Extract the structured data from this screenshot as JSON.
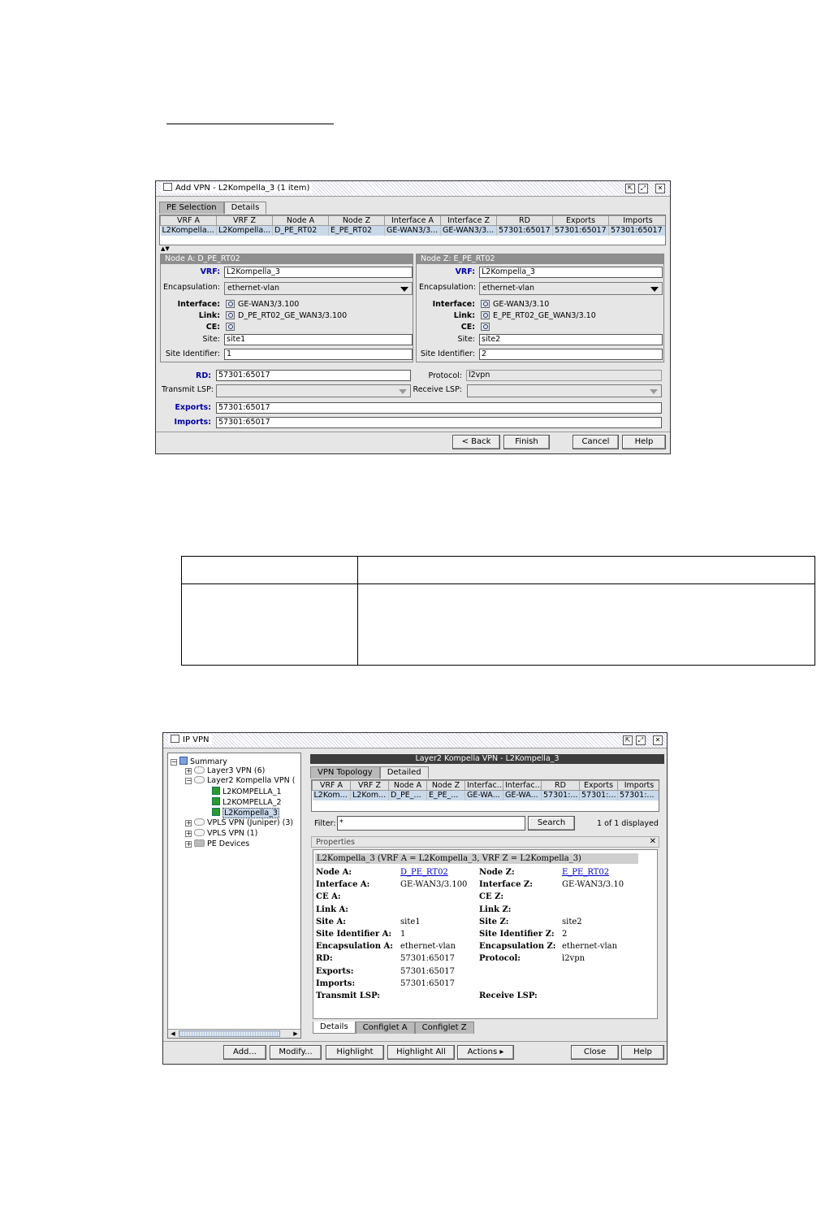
{
  "dialog1": {
    "title": "Add VPN - L2Kompella_3 (1 item)",
    "tabs": [
      "PE Selection",
      "Details"
    ],
    "columns": [
      "VRF A",
      "VRF Z",
      "Node A",
      "Node Z",
      "Interface A",
      "Interface Z",
      "RD",
      "Exports",
      "Imports"
    ],
    "row": [
      "L2Kompella...",
      "L2Kompella...",
      "D_PE_RT02",
      "E_PE_RT02",
      "GE-WAN3/3...",
      "GE-WAN3/3...",
      "57301:65017",
      "57301:65017",
      "57301:65017"
    ],
    "nodeA": {
      "header": "Node A: D_PE_RT02",
      "vrf_label": "VRF:",
      "vrf": "L2Kompella_3",
      "encap_label": "Encapsulation:",
      "encap": "ethernet-vlan",
      "interface_label": "Interface:",
      "interface": "GE-WAN3/3.100",
      "link_label": "Link:",
      "link": "D_PE_RT02_GE_WAN3/3.100",
      "ce_label": "CE:",
      "site_label": "Site:",
      "site": "site1",
      "siteid_label": "Site Identifier:",
      "siteid": "1"
    },
    "nodeZ": {
      "header": "Node Z: E_PE_RT02",
      "vrf_label": "VRF:",
      "vrf": "L2Kompella_3",
      "encap_label": "Encapsulation:",
      "encap": "ethernet-vlan",
      "interface_label": "Interface:",
      "interface": "GE-WAN3/3.10",
      "link_label": "Link:",
      "link": "E_PE_RT02_GE_WAN3/3.10",
      "ce_label": "CE:",
      "site_label": "Site:",
      "site": "site2",
      "siteid_label": "Site Identifier:",
      "siteid": "2"
    },
    "rd_label": "RD:",
    "rd": "57301:65017",
    "protocol_label": "Protocol:",
    "protocol": "l2vpn",
    "tx_label": "Transmit LSP:",
    "rx_label": "Receive LSP:",
    "exports_label": "Exports:",
    "exports": "57301:65017",
    "imports_label": "Imports:",
    "imports": "57301:65017",
    "buttons": {
      "back": "< Back",
      "finish": "Finish",
      "cancel": "Cancel",
      "help": "Help"
    }
  },
  "dialog2": {
    "title": "IP VPN",
    "tree": {
      "summary": "Summary",
      "l3": "Layer3 VPN (6)",
      "l2k": "Layer2 Kompella VPN (",
      "k1": "L2KOMPELLA_1",
      "k2": "L2KOMPELLA_2",
      "k3": "L2Kompella_3",
      "vplsj": "VPLS VPN (Juniper) (3)",
      "vpls": "VPLS VPN (1)",
      "pe": "PE Devices"
    },
    "header": "Layer2 Kompella VPN - L2Kompella_3",
    "tabs": [
      "VPN Topology",
      "Detailed"
    ],
    "columns": [
      "VRF A",
      "VRF Z",
      "Node A",
      "Node Z",
      "Interfac...",
      "Interfac...",
      "RD",
      "Exports",
      "Imports"
    ],
    "row": [
      "L2Kom...",
      "L2Kom...",
      "D_PE_...",
      "E_PE_...",
      "GE-WA...",
      "GE-WA...",
      "57301:...",
      "57301:...",
      "57301:..."
    ],
    "filter_label": "Filter:",
    "filter_value": "*",
    "search_button": "Search",
    "count": "1 of 1 displayed",
    "properties_title": "Properties",
    "close_glyph": "✕",
    "props_heading": "L2Kompella_3   (VRF A = L2Kompella_3, VRF Z = L2Kompella_3)",
    "left": [
      {
        "k": "Node A:",
        "v": "D_PE_RT02"
      },
      {
        "k": "Interface A:",
        "v": "GE-WAN3/3.100"
      },
      {
        "k": "CE A:",
        "v": ""
      },
      {
        "k": "Link A:",
        "v": ""
      },
      {
        "k": "Site A:",
        "v": "site1"
      },
      {
        "k": "Site Identifier A:",
        "v": "1"
      },
      {
        "k": "Encapsulation A:",
        "v": "ethernet-vlan"
      },
      {
        "k": "RD:",
        "v": "57301:65017"
      },
      {
        "k": "Exports:",
        "v": "57301:65017"
      },
      {
        "k": "Imports:",
        "v": "57301:65017"
      },
      {
        "k": "Transmit LSP:",
        "v": ""
      }
    ],
    "right": [
      {
        "k": "Node Z:",
        "v": "E_PE_RT02"
      },
      {
        "k": "Interface Z:",
        "v": "GE-WAN3/3.10"
      },
      {
        "k": "CE Z:",
        "v": ""
      },
      {
        "k": "Link Z:",
        "v": ""
      },
      {
        "k": "Site Z:",
        "v": "site2"
      },
      {
        "k": "Site Identifier Z:",
        "v": "2"
      },
      {
        "k": "Encapsulation Z:",
        "v": "ethernet-vlan"
      },
      {
        "k": "Protocol:",
        "v": "l2vpn"
      },
      {
        "k": "",
        "v": ""
      },
      {
        "k": "",
        "v": ""
      },
      {
        "k": "Receive LSP:",
        "v": ""
      }
    ],
    "bottom_tabs": [
      "Details",
      "Configlet A",
      "Configlet Z"
    ],
    "buttons": {
      "add": "Add...",
      "modify": "Modify...",
      "highlight": "Highlight",
      "highlight_all": "Highlight All",
      "actions": "Actions ▸",
      "close": "Close",
      "help": "Help"
    }
  }
}
